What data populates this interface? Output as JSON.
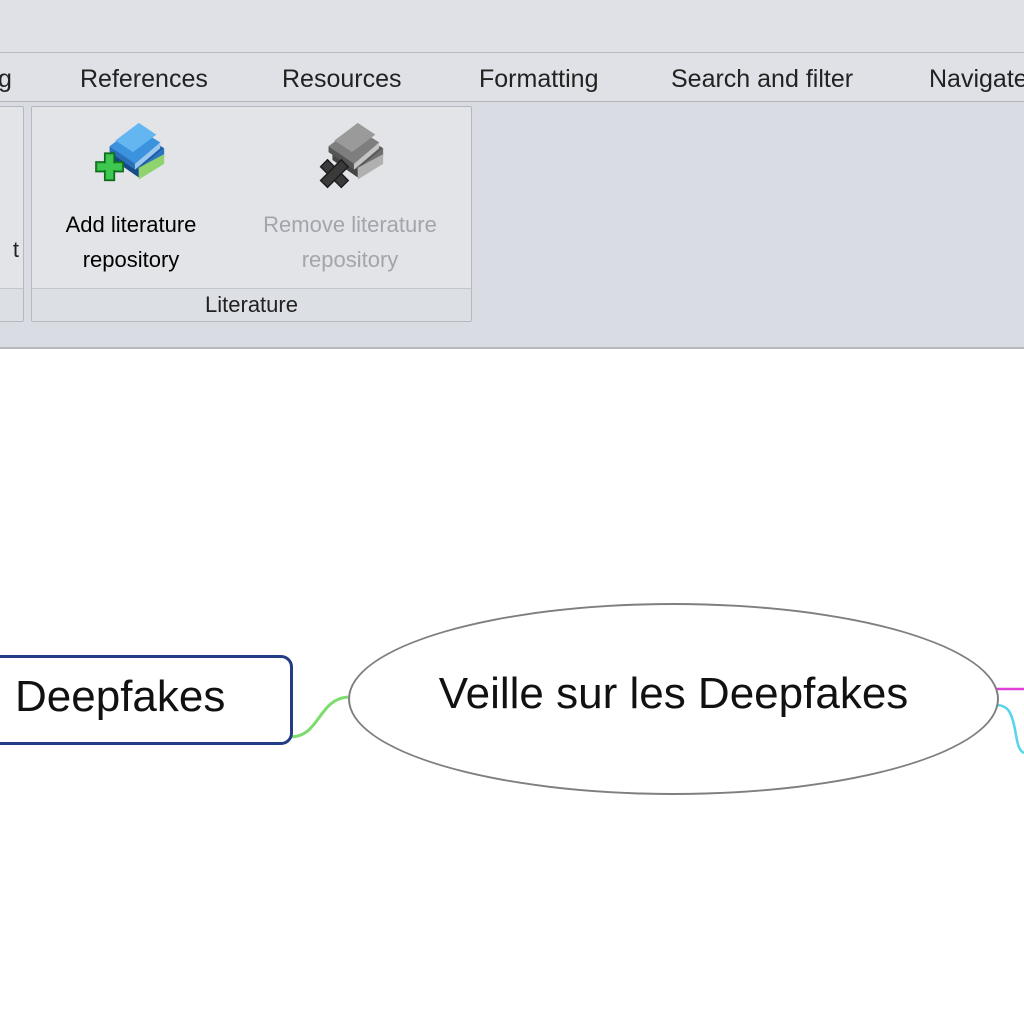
{
  "tabs": [
    {
      "label": "g"
    },
    {
      "label": "References"
    },
    {
      "label": "Resources"
    },
    {
      "label": "Formatting"
    },
    {
      "label": "Search and filter"
    },
    {
      "label": "Navigate"
    }
  ],
  "ribbon": {
    "left_partial_label": "t",
    "literature_group": {
      "label": "Literature",
      "add": {
        "label_line1": "Add literature",
        "label_line2": "repository",
        "icon": "add-books-icon"
      },
      "remove": {
        "label_line1": "Remove literature",
        "label_line2": "repository",
        "icon": "remove-books-icon",
        "disabled": true
      }
    }
  },
  "mindmap": {
    "central": {
      "text": "Veille sur les Deepfakes"
    },
    "left_topic": {
      "text": "Deepfakes"
    }
  },
  "colors": {
    "link_green": "#7ddc6e",
    "link_magenta": "#e040d8",
    "link_cyan": "#55d4ec",
    "topic_border": "#233c86"
  }
}
